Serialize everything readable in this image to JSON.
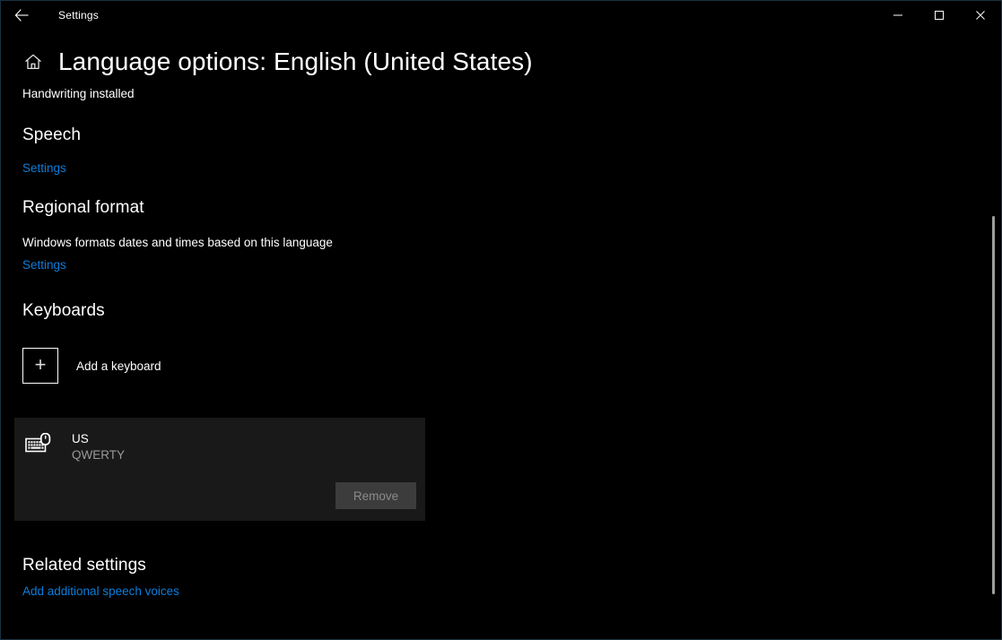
{
  "window": {
    "titlebar": {
      "back_label": "back-arrow",
      "title": "Settings",
      "minimize": "minimize",
      "maximize": "maximize",
      "close": "close"
    }
  },
  "page": {
    "home_icon": "home-icon",
    "title": "Language options: English (United States)",
    "subtitle": "Handwriting installed"
  },
  "sections": {
    "speech": {
      "heading": "Speech",
      "settings_link": "Settings"
    },
    "regional_format": {
      "heading": "Regional format",
      "description": "Windows formats dates and times based on this language",
      "settings_link": "Settings"
    },
    "keyboards": {
      "heading": "Keyboards",
      "add_keyboard_label": "Add a keyboard",
      "add_keyboard_plus": "+",
      "installed": [
        {
          "name": "US",
          "layout": "QWERTY",
          "remove_label": "Remove"
        }
      ]
    },
    "related_settings": {
      "heading": "Related settings",
      "links": [
        "Add additional speech voices"
      ]
    }
  },
  "colors": {
    "background": "#000000",
    "link": "#0d7ddb",
    "card": "#191919",
    "disabled_button_bg": "#3c3c3c",
    "disabled_button_text": "#8b8b8b",
    "secondary_text": "#9a9a9a",
    "window_border": "#19303f",
    "scrollbar_thumb": "#9d9d9d"
  }
}
